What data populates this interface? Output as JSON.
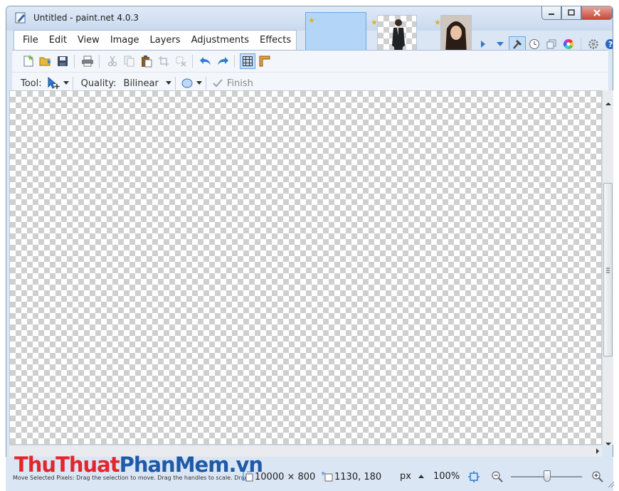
{
  "window": {
    "title": "Untitled - paint.net 4.0.3",
    "controls": [
      "minimize",
      "maximize",
      "close"
    ]
  },
  "menu": {
    "items": [
      "File",
      "Edit",
      "View",
      "Image",
      "Layers",
      "Adjustments",
      "Effects"
    ]
  },
  "toolbar": {
    "buttons": [
      "new-image-icon",
      "open-icon",
      "save-icon",
      "print-icon",
      "cut-icon",
      "copy-icon",
      "paste-icon",
      "crop-icon",
      "deselect-icon",
      "undo-icon",
      "redo-icon",
      "grid-icon",
      "ruler-icon"
    ]
  },
  "tool_options": {
    "tool_label": "Tool:",
    "quality_label": "Quality:",
    "quality_value": "Bilinear",
    "finish_label": "Finish"
  },
  "status": {
    "hint": "Move Selected Pixels: Drag the selection to move. Drag the handles to scale. Drag...",
    "image_size": "10000 × 800",
    "cursor_position": "1130, 180",
    "units": "px",
    "zoom": "100%"
  },
  "watermark": {
    "part1": "ThuThuat",
    "part2": "PhanMem.vn"
  },
  "colors": {
    "frame": "#dbe6f4",
    "accent": "#3a84d6",
    "watermark_red": "#e3262b",
    "watermark_blue": "#1f5aa8"
  }
}
